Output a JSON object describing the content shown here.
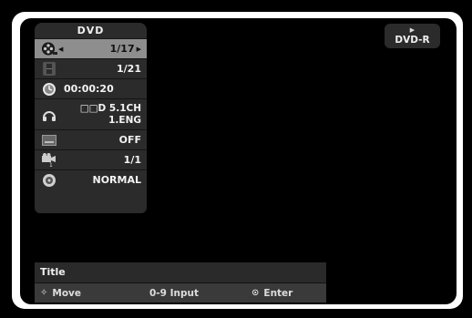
{
  "panel": {
    "header": "DVD",
    "rows": [
      {
        "icon": "disc-reel-icon",
        "value": "1/17",
        "selected": true
      },
      {
        "icon": "film-chapter-icon",
        "value": "1/21"
      },
      {
        "icon": "clock-icon",
        "value": "00:00:20"
      },
      {
        "icon": "headphones-icon",
        "line1": "□□D 5.1CH",
        "line2": "1.ENG"
      },
      {
        "icon": "subtitle-icon",
        "value": "OFF"
      },
      {
        "icon": "camera-angle-icon",
        "value": "1/1"
      },
      {
        "icon": "sound-icon",
        "value": "NORMAL"
      }
    ]
  },
  "status": {
    "play_glyph": "▶",
    "disc_type": "DVD-R"
  },
  "help": {
    "title": "Title",
    "move_glyph": "✧",
    "move_label": "Move",
    "input_label": "0-9 Input",
    "enter_glyph": "⊙",
    "enter_label": "Enter"
  },
  "colors": {
    "panel_bg": "#2b2b2b",
    "selected_row": "#8e8e8e",
    "frame": "#ffffff",
    "screen": "#000000"
  }
}
